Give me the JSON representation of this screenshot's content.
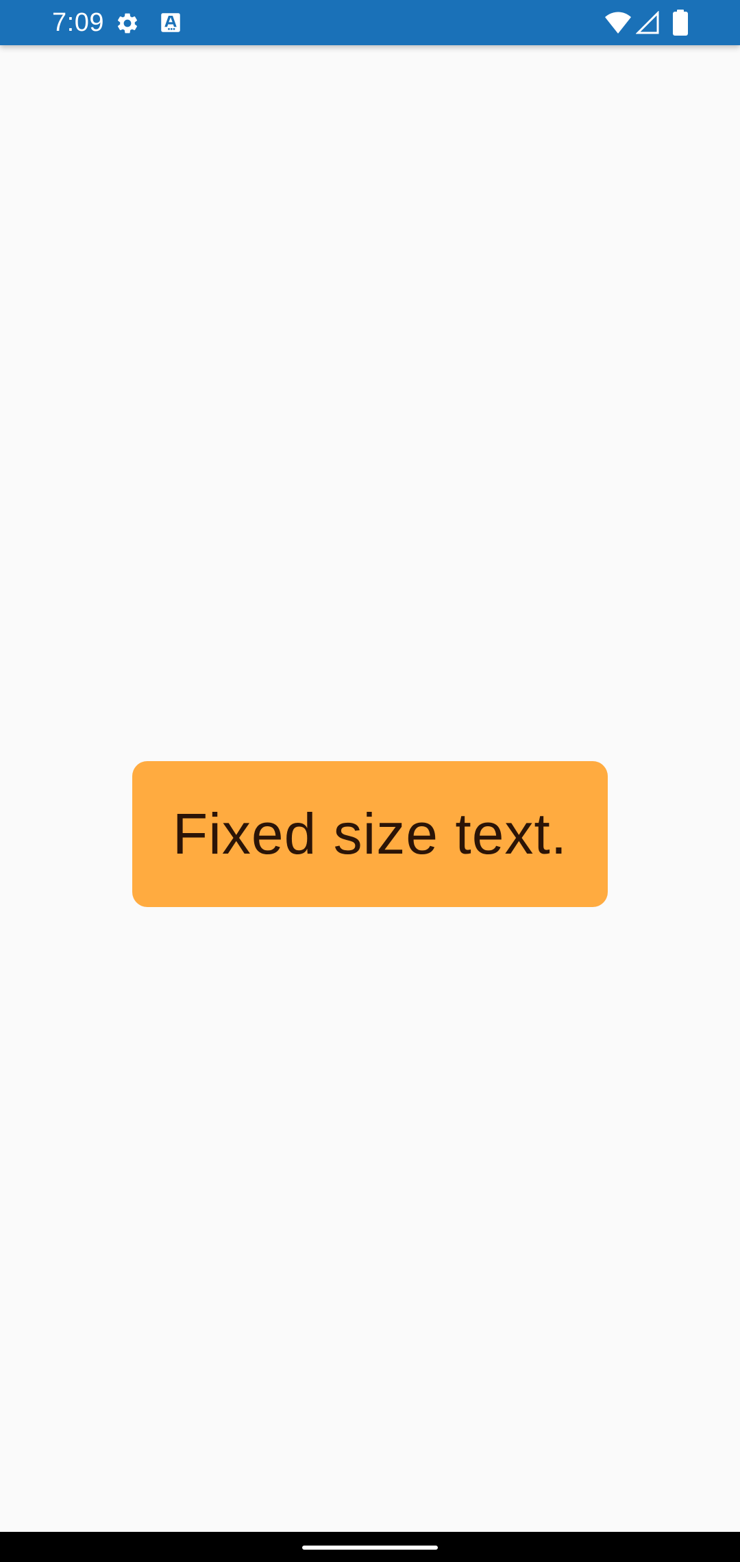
{
  "status_bar": {
    "time": "7:09",
    "icons": [
      "settings-icon",
      "a-icon",
      "wifi-icon",
      "signal-icon",
      "battery-icon"
    ],
    "background": "#1a71b8"
  },
  "main": {
    "label_text": "Fixed size text.",
    "label_background": "#ffab40",
    "label_text_color": "#2b1407"
  },
  "nav_bar": {
    "background": "#000000"
  }
}
